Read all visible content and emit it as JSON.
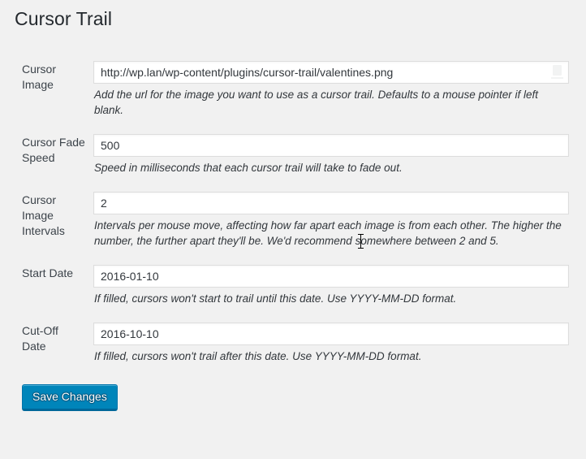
{
  "page": {
    "title": "Cursor Trail"
  },
  "fields": [
    {
      "label": "Cursor Image",
      "value": "http://wp.lan/wp-content/plugins/cursor-trail/valentines.png",
      "description": "Add the url for the image you want to use as a cursor trail. Defaults to a mouse pointer if left blank."
    },
    {
      "label": "Cursor Fade Speed",
      "value": "500",
      "description": "Speed in milliseconds that each cursor trail will take to fade out."
    },
    {
      "label": "Cursor Image Intervals",
      "value": "2",
      "description": "Intervals per mouse move, affecting how far apart each image is from each other. The higher the number, the further apart they'll be. We'd recommend somewhere between 2 and 5."
    },
    {
      "label": "Start Date",
      "value": "2016-01-10",
      "description": "If filled, cursors won't start to trail until this date. Use YYYY-MM-DD format."
    },
    {
      "label": "Cut-Off Date",
      "value": "2016-10-10",
      "description": "If filled, cursors won't trail after this date. Use YYYY-MM-DD format."
    }
  ],
  "submit": {
    "label": "Save Changes"
  },
  "colors": {
    "page_background": "#f1f1f1",
    "heading": "#23282d",
    "button_primary": "#0085ba",
    "button_primary_border": "#006799",
    "input_border": "#dddddd",
    "description_text": "#32373c"
  },
  "icons": {
    "autofill": "autofill-icon",
    "pointer": "text-ibeam-cursor"
  }
}
